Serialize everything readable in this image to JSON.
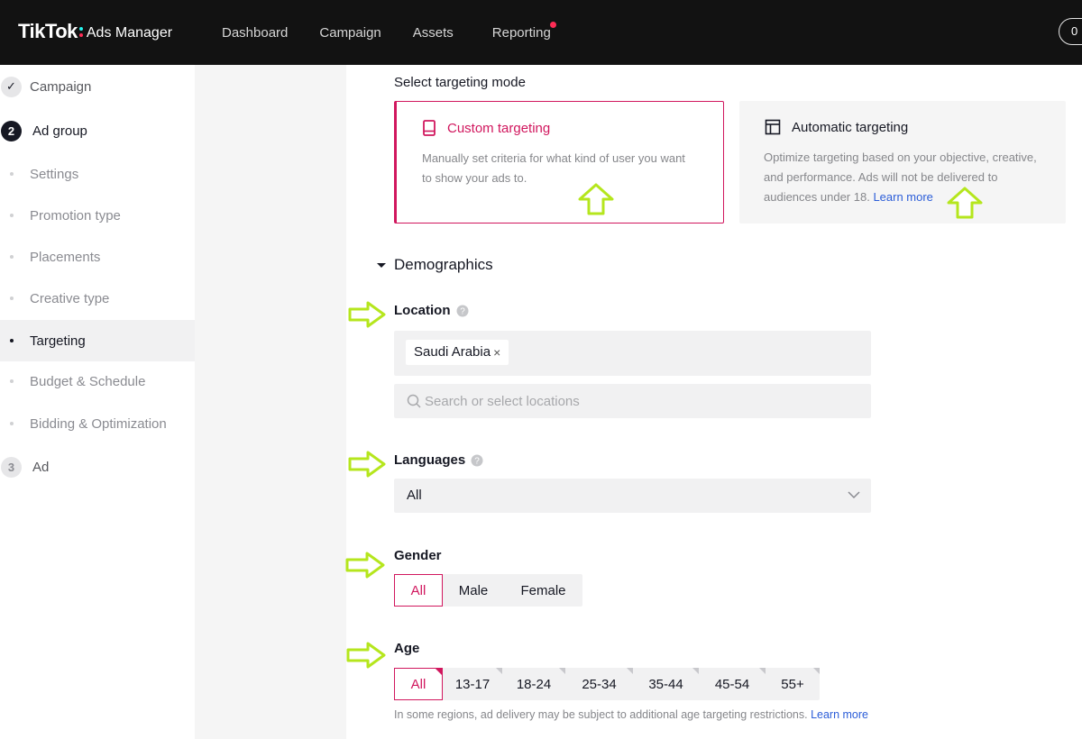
{
  "header": {
    "brand_name": "TikTok",
    "brand_product": "Ads Manager",
    "nav": [
      "Dashboard",
      "Campaign",
      "Assets",
      "Reporting"
    ],
    "account_button": "0"
  },
  "sidebar": {
    "steps": [
      {
        "label": "Campaign",
        "marker": "✓"
      },
      {
        "label": "Ad group",
        "marker": "2"
      },
      {
        "label": "Ad",
        "marker": "3"
      }
    ],
    "substeps": [
      "Settings",
      "Promotion type",
      "Placements",
      "Creative type",
      "Targeting",
      "Budget & Schedule",
      "Bidding & Optimization"
    ]
  },
  "targeting_mode": {
    "title": "Select targeting mode",
    "custom": {
      "title": "Custom targeting",
      "description_line1": "Manually set criteria for what kind of user you want",
      "description_line2": "to show your ads to."
    },
    "automatic": {
      "title": "Automatic targeting",
      "description_line1": "Optimize targeting based on your objective, creative,",
      "description_line2": "and performance. Ads will not be delivered to",
      "description_line3": "audiences under 18.",
      "learn_more": "Learn more"
    }
  },
  "demographics": {
    "title": "Demographics",
    "location": {
      "label": "Location",
      "selected": "Saudi Arabia",
      "remove": "×",
      "placeholder": "Search or select locations"
    },
    "languages": {
      "label": "Languages",
      "value": "All"
    },
    "gender": {
      "label": "Gender",
      "options": [
        "All",
        "Male",
        "Female"
      ]
    },
    "age": {
      "label": "Age",
      "options": [
        "All",
        "13-17",
        "18-24",
        "25-34",
        "35-44",
        "45-54",
        "55+"
      ],
      "note": "In some regions, ad delivery may be subject to additional age targeting restrictions.",
      "learn_more": "Learn more"
    }
  },
  "colors": {
    "accent": "#d1175e",
    "arrow": "#b5e61d",
    "topbar": "#121212",
    "link": "#2b5dd8"
  },
  "icons": {
    "custom_card": "phone-icon",
    "auto_card": "layout-icon",
    "help": "help-icon",
    "search": "search-icon",
    "dropdown": "chevron-down-icon",
    "collapse": "caret-down-icon"
  }
}
